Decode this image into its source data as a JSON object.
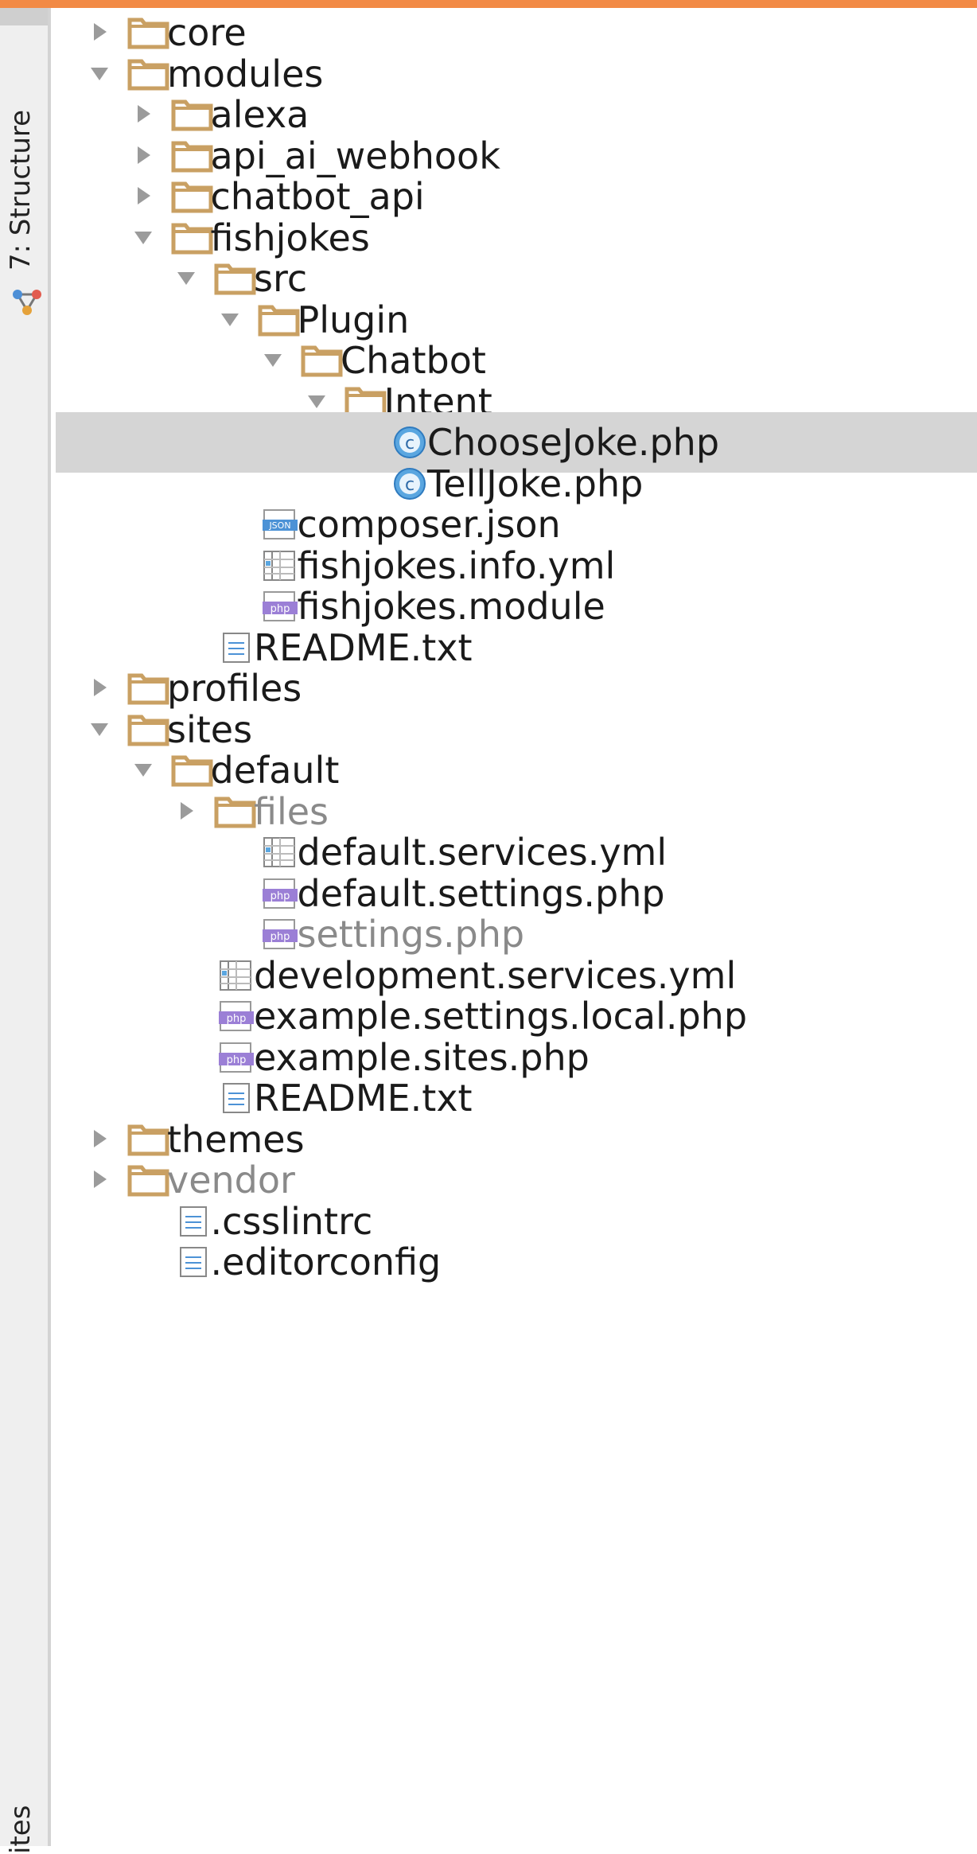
{
  "sidebar": {
    "structure_tab": "7: Structure",
    "bottom_tab": "ites"
  },
  "colors": {
    "folder": "#c9a063",
    "accent": "#f28a45",
    "selected": "#d5d5d5",
    "class_icon": "#5aa6e0",
    "php_icon": "#9b7fd6"
  },
  "tree": [
    {
      "label": "core",
      "depth": 0,
      "kind": "folder",
      "expanded": false,
      "dim": false
    },
    {
      "label": "modules",
      "depth": 0,
      "kind": "folder",
      "expanded": true,
      "dim": false
    },
    {
      "label": "alexa",
      "depth": 1,
      "kind": "folder",
      "expanded": false,
      "dim": false
    },
    {
      "label": "api_ai_webhook",
      "depth": 1,
      "kind": "folder",
      "expanded": false,
      "dim": false
    },
    {
      "label": "chatbot_api",
      "depth": 1,
      "kind": "folder",
      "expanded": false,
      "dim": false
    },
    {
      "label": "fishjokes",
      "depth": 1,
      "kind": "folder",
      "expanded": true,
      "dim": false
    },
    {
      "label": "src",
      "depth": 2,
      "kind": "folder",
      "expanded": true,
      "dim": false
    },
    {
      "label": "Plugin",
      "depth": 3,
      "kind": "folder",
      "expanded": true,
      "dim": false
    },
    {
      "label": "Chatbot",
      "depth": 4,
      "kind": "folder",
      "expanded": true,
      "dim": false
    },
    {
      "label": "Intent",
      "depth": 5,
      "kind": "folder",
      "expanded": true,
      "dim": false
    },
    {
      "label": "ChooseJoke.php",
      "depth": 6,
      "kind": "class",
      "selected": true,
      "dim": false
    },
    {
      "label": "TellJoke.php",
      "depth": 6,
      "kind": "class",
      "dim": false
    },
    {
      "label": "composer.json",
      "depth": 3,
      "kind": "json",
      "dim": false
    },
    {
      "label": "fishjokes.info.yml",
      "depth": 3,
      "kind": "yml",
      "dim": false
    },
    {
      "label": "fishjokes.module",
      "depth": 3,
      "kind": "php",
      "dim": false
    },
    {
      "label": "README.txt",
      "depth": 2,
      "kind": "txt",
      "dim": false
    },
    {
      "label": "profiles",
      "depth": 0,
      "kind": "folder",
      "expanded": false,
      "dim": false
    },
    {
      "label": "sites",
      "depth": 0,
      "kind": "folder",
      "expanded": true,
      "dim": false
    },
    {
      "label": "default",
      "depth": 1,
      "kind": "folder",
      "expanded": true,
      "dim": false
    },
    {
      "label": "files",
      "depth": 2,
      "kind": "folder",
      "expanded": false,
      "dim": true
    },
    {
      "label": "default.services.yml",
      "depth": 3,
      "kind": "yml",
      "dim": false
    },
    {
      "label": "default.settings.php",
      "depth": 3,
      "kind": "php",
      "dim": false
    },
    {
      "label": "settings.php",
      "depth": 3,
      "kind": "php",
      "dim": true
    },
    {
      "label": "development.services.yml",
      "depth": 2,
      "kind": "yml",
      "dim": false
    },
    {
      "label": "example.settings.local.php",
      "depth": 2,
      "kind": "php",
      "dim": false
    },
    {
      "label": "example.sites.php",
      "depth": 2,
      "kind": "php",
      "dim": false
    },
    {
      "label": "README.txt",
      "depth": 2,
      "kind": "txt",
      "dim": false
    },
    {
      "label": "themes",
      "depth": 0,
      "kind": "folder",
      "expanded": false,
      "dim": false
    },
    {
      "label": "vendor",
      "depth": 0,
      "kind": "folder",
      "expanded": false,
      "dim": true
    },
    {
      "label": ".csslintrc",
      "depth": 1,
      "kind": "txt",
      "dim": false
    },
    {
      "label": ".editorconfig",
      "depth": 1,
      "kind": "txt",
      "dim": false
    }
  ]
}
